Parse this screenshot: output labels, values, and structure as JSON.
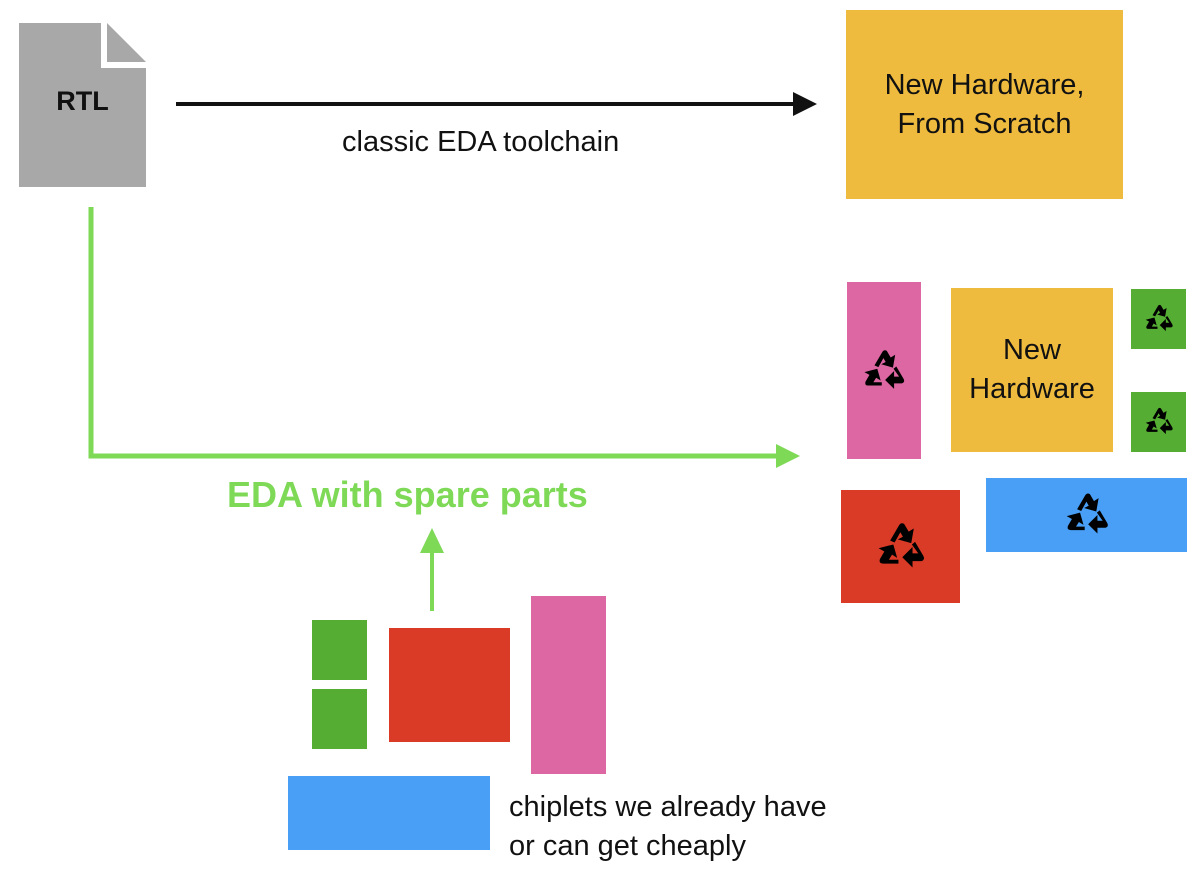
{
  "rtl_doc": {
    "label": "RTL",
    "color": "#a8a8a8"
  },
  "classic_path": {
    "label": "classic EDA toolchain",
    "color": "#000000"
  },
  "scratch_box": {
    "line1": "New Hardware,",
    "line2": "From Scratch",
    "color": "#efbb3e"
  },
  "spare_path": {
    "label": "EDA with spare parts",
    "color": "#7ed957"
  },
  "result_cluster": {
    "new_hardware": {
      "line1": "New",
      "line2": "Hardware"
    },
    "recycled_chiplets": [
      {
        "color": "pink",
        "icon": "recycle-icon"
      },
      {
        "color": "green",
        "icon": "recycle-icon"
      },
      {
        "color": "green",
        "icon": "recycle-icon"
      },
      {
        "color": "red",
        "icon": "recycle-icon"
      },
      {
        "color": "blue",
        "icon": "recycle-icon"
      }
    ]
  },
  "chiplet_pool": {
    "caption_line1": "chiplets we already have",
    "caption_line2": "or can get cheaply",
    "chiplets": [
      "green",
      "green",
      "red",
      "pink",
      "blue"
    ]
  },
  "colors": {
    "yellow": "#efbb3e",
    "pink": "#dd67a3",
    "green": "#55ad33",
    "red": "#d93b27",
    "blue": "#489ff5",
    "arrow_green": "#7ed957",
    "doc_gray": "#a8a8a8"
  }
}
